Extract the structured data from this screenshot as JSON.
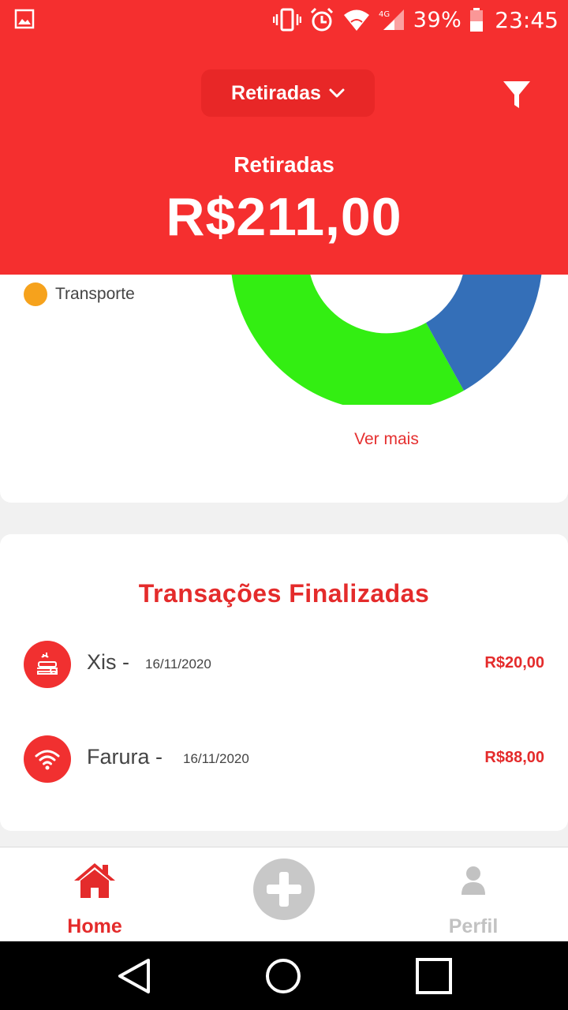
{
  "status_bar": {
    "battery_percent": "39%",
    "network": "4G",
    "time": "23:45",
    "icons": [
      "image-icon",
      "vibrate-icon",
      "alarm-icon",
      "wifi-icon",
      "signal-icon",
      "battery-icon"
    ]
  },
  "header": {
    "dropdown_label": "Retiradas",
    "title": "Retiradas",
    "amount": "R$211,00",
    "background_color": "#f52f2f"
  },
  "chart_card": {
    "legend": [
      {
        "label": "Transporte",
        "color": "#f6a21c"
      }
    ],
    "segment_colors": [
      "#33ee12",
      "#346fb8"
    ],
    "link_label": "Ver mais"
  },
  "transactions": {
    "title": "Transações Finalizadas",
    "items": [
      {
        "name": "Xis",
        "separator": "-",
        "date": "16/11/2020",
        "amount": "R$20,00",
        "icon": "food-icon"
      },
      {
        "name": "Farura",
        "separator": "-",
        "date": "16/11/2020",
        "amount": "R$88,00",
        "icon": "wifi-icon"
      }
    ]
  },
  "bottom_nav": {
    "home_label": "Home",
    "add_icon": "plus-icon",
    "profile_label": "Perfil",
    "active_color": "#e42b2b",
    "inactive_color": "#c2c2c2"
  }
}
